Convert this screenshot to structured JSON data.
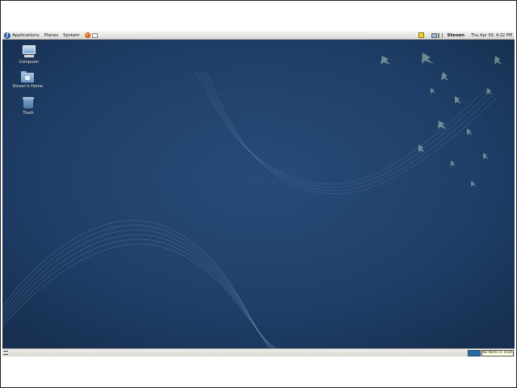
{
  "top_panel": {
    "menus": [
      "Applications",
      "Places",
      "System"
    ],
    "user": "Steven",
    "clock": "Thu Apr 30,  4:22 PM"
  },
  "desktop": {
    "icons": [
      {
        "label": "Computer",
        "icon": "computer-icon"
      },
      {
        "label": "Steven's Home",
        "icon": "home-folder-icon"
      },
      {
        "label": "Trash",
        "icon": "trash-icon"
      }
    ]
  },
  "bottom_panel": {
    "trash_tooltip": "No Items in Trash"
  },
  "colors": {
    "wallpaper": "#1f3f68",
    "panel": "#e6e4df",
    "workspace": "#2d6aa3"
  }
}
